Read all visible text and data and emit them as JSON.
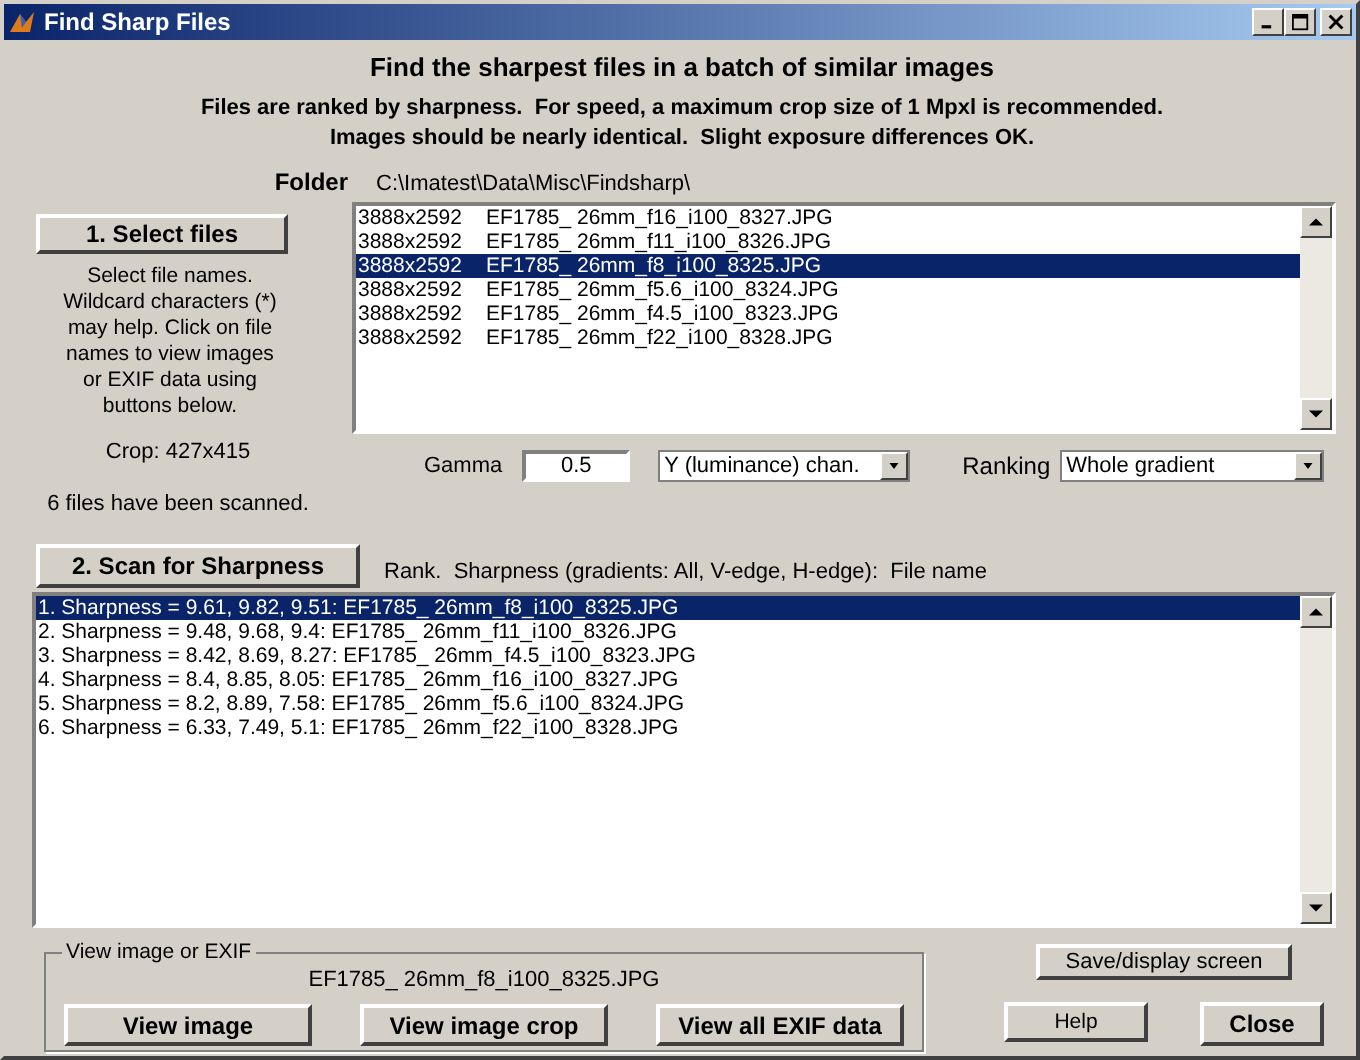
{
  "window": {
    "title": "Find Sharp Files"
  },
  "heading": "Find the sharpest files in a batch of similar images",
  "intro": [
    "Files are ranked by sharpness.  For speed, a maximum crop size of 1 Mpxl is recommended.",
    "Images should be nearly identical.  Slight exposure differences OK."
  ],
  "folder": {
    "label": "Folder",
    "path": "C:\\Imatest\\Data\\Misc\\Findsharp\\"
  },
  "select_button": "1. Select files",
  "select_help": "Select file names. Wildcard characters (*) may help. Click on file names to view images or EXIF data using buttons below.",
  "crop": "Crop: 427x415",
  "scanned": "6 files have been scanned.",
  "files": [
    {
      "size": "3888x2592",
      "name": "EF1785_ 26mm_f16_i100_8327.JPG",
      "selected": false
    },
    {
      "size": "3888x2592",
      "name": "EF1785_ 26mm_f11_i100_8326.JPG",
      "selected": false
    },
    {
      "size": "3888x2592",
      "name": "EF1785_ 26mm_f8_i100_8325.JPG",
      "selected": true
    },
    {
      "size": "3888x2592",
      "name": "EF1785_ 26mm_f5.6_i100_8324.JPG",
      "selected": false
    },
    {
      "size": "3888x2592",
      "name": "EF1785_ 26mm_f4.5_i100_8323.JPG",
      "selected": false
    },
    {
      "size": "3888x2592",
      "name": "EF1785_ 26mm_f22_i100_8328.JPG",
      "selected": false
    }
  ],
  "gamma": {
    "label": "Gamma",
    "value": "0.5"
  },
  "channel": {
    "value": "Y (luminance) chan."
  },
  "ranking": {
    "label": "Ranking",
    "value": "Whole gradient"
  },
  "scan_button": "2. Scan for Sharpness",
  "results_header": "Rank.  Sharpness (gradients: All, V-edge, H-edge):  File name",
  "results": [
    {
      "text": "1.  Sharpness = 9.61, 9.82, 9.51:   EF1785_ 26mm_f8_i100_8325.JPG",
      "selected": true
    },
    {
      "text": "2.  Sharpness = 9.48, 9.68, 9.4:   EF1785_ 26mm_f11_i100_8326.JPG",
      "selected": false
    },
    {
      "text": "3.  Sharpness = 8.42, 8.69, 8.27:   EF1785_ 26mm_f4.5_i100_8323.JPG",
      "selected": false
    },
    {
      "text": "4.  Sharpness = 8.4, 8.85, 8.05:   EF1785_ 26mm_f16_i100_8327.JPG",
      "selected": false
    },
    {
      "text": "5.  Sharpness = 8.2, 8.89, 7.58:   EF1785_ 26mm_f5.6_i100_8324.JPG",
      "selected": false
    },
    {
      "text": "6.  Sharpness = 6.33, 7.49, 5.1:   EF1785_ 26mm_f22_i100_8328.JPG",
      "selected": false
    }
  ],
  "view_group": {
    "title": "View image or EXIF",
    "file": "EF1785_ 26mm_f8_i100_8325.JPG",
    "buttons": [
      "View image",
      "View image crop",
      "View all EXIF data"
    ]
  },
  "save_button": "Save/display screen",
  "help_button": "Help",
  "close_button": "Close"
}
